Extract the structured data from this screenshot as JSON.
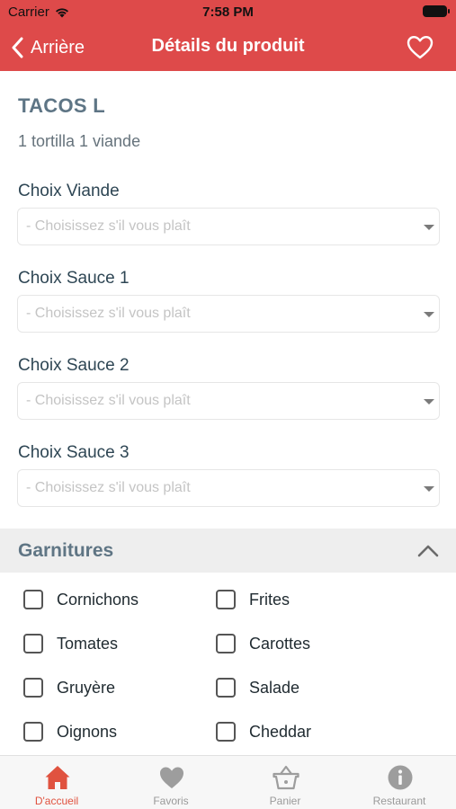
{
  "status_bar": {
    "carrier": "Carrier",
    "time": "7:58 PM"
  },
  "nav": {
    "back_label": "Arrière",
    "title": "Détails du produit"
  },
  "product": {
    "name": "TACOS L",
    "description": "1 tortilla 1 viande"
  },
  "options": [
    {
      "label": "Choix Viande",
      "placeholder": "- Choisissez s'il vous plaît"
    },
    {
      "label": "Choix Sauce 1",
      "placeholder": "- Choisissez s'il vous plaît"
    },
    {
      "label": "Choix Sauce 2",
      "placeholder": "- Choisissez s'il vous plaît"
    },
    {
      "label": "Choix Sauce 3",
      "placeholder": "- Choisissez s'il vous plaît"
    }
  ],
  "garnitures": {
    "title": "Garnitures",
    "items": [
      {
        "label": "Cornichons",
        "checked": false
      },
      {
        "label": "Frites",
        "checked": false
      },
      {
        "label": "Tomates",
        "checked": false
      },
      {
        "label": "Carottes",
        "checked": false
      },
      {
        "label": "Gruyère",
        "checked": false
      },
      {
        "label": "Salade",
        "checked": false
      },
      {
        "label": "Oignons",
        "checked": false
      },
      {
        "label": "Cheddar",
        "checked": false
      }
    ]
  },
  "tab_bar": {
    "items": [
      {
        "label": "D'accueil",
        "icon": "home-icon",
        "active": true
      },
      {
        "label": "Favoris",
        "icon": "heart-icon",
        "active": false
      },
      {
        "label": "Panier",
        "icon": "basket-icon",
        "active": false
      },
      {
        "label": "Restaurant",
        "icon": "info-icon",
        "active": false
      }
    ]
  },
  "colors": {
    "accent": "#de4a4a",
    "active_tab": "#e0523f",
    "heading": "#5e7585"
  }
}
